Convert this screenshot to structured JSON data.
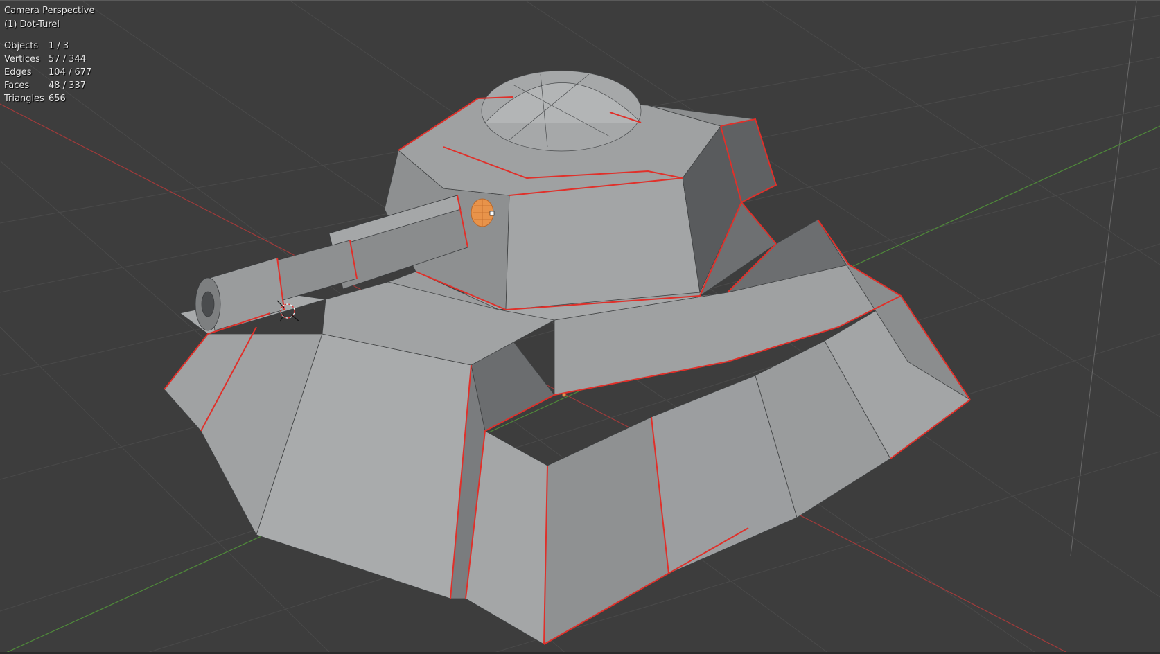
{
  "viewport": {
    "view_name": "Camera Perspective",
    "active_object": "(1) Dot-Turel",
    "stats": [
      {
        "label": "Objects",
        "value": "1 / 3"
      },
      {
        "label": "Vertices",
        "value": "57 / 344"
      },
      {
        "label": "Edges",
        "value": "104 / 677"
      },
      {
        "label": "Faces",
        "value": "48 / 337"
      },
      {
        "label": "Triangles",
        "value": "656"
      }
    ]
  },
  "colors": {
    "background": "#3d3d3d",
    "grid": "#4a4a4a",
    "x_axis": "#b03a3a",
    "y_axis": "#4f8a3a",
    "mesh_light": "#a5a7a8",
    "mesh_mid": "#8c8e8f",
    "mesh_dark": "#66686a",
    "seam": "#e0302a",
    "light_object": "#e8934a"
  },
  "icons": {
    "light": "sun-light-icon",
    "cursor": "3d-cursor-icon"
  }
}
